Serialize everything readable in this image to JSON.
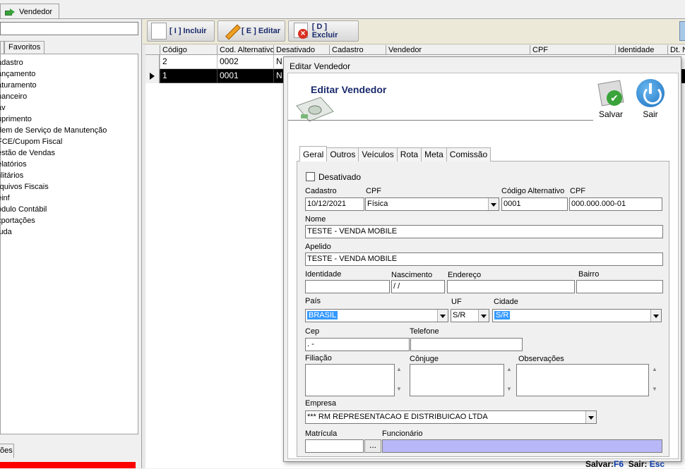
{
  "top_tab": {
    "label": "Vendedor"
  },
  "left": {
    "tabs": [
      "Favoritos"
    ],
    "tree": [
      "adastro",
      "ançamento",
      "aturamento",
      "nanceiro",
      "av",
      "uprimento",
      "dem de Serviço de Manutenção",
      "FCE/Cupom Fiscal",
      "estão de Vendas",
      "elatórios",
      "tilitários",
      "rquivos Fiscais",
      "einf",
      "ódulo Contábil",
      "xportações",
      "juda"
    ],
    "bottom_tab": "ões"
  },
  "toolbar": {
    "incluir": "[ I ] Incluir",
    "editar": "[ E ] Editar",
    "excluir": "[ D ] Excluir"
  },
  "grid": {
    "columns": [
      "Código",
      "Cod. Alternativo",
      "Desativado",
      "Cadastro",
      "Vendedor",
      "CPF",
      "Identidade",
      "Dt. N"
    ],
    "rows": [
      {
        "codigo": "2",
        "cod_alt": "0002",
        "desativado": "N"
      },
      {
        "codigo": "1",
        "cod_alt": "0001",
        "desativado": "N"
      }
    ]
  },
  "dialog": {
    "title": "Editar Vendedor",
    "header": "Editar Vendedor",
    "save_label": "Salvar",
    "exit_label": "Sair",
    "tabs": [
      "Geral",
      "Outros",
      "Veículos",
      "Rota",
      "Meta",
      "Comissão"
    ],
    "form": {
      "desativado_label": "Desativado",
      "cadastro_label": "Cadastro",
      "cadastro_value": "10/12/2021",
      "cpf_type_label": "CPF",
      "cpf_type_value": "Física",
      "cod_alt_label": "Código Alternativo",
      "cod_alt_value": "0001",
      "cpf_label": "CPF",
      "cpf_value": "000.000.000-01",
      "nome_label": "Nome",
      "nome_value": "TESTE - VENDA MOBILE",
      "apelido_label": "Apelido",
      "apelido_value": "TESTE - VENDA MOBILE",
      "identidade_label": "Identidade",
      "identidade_value": "",
      "nascimento_label": "Nascimento",
      "nascimento_value": " /  /",
      "endereco_label": "Endereço",
      "endereco_value": "",
      "bairro_label": "Bairro",
      "bairro_value": "",
      "pais_label": "País",
      "pais_value": "BRASIL",
      "uf_label": "UF",
      "uf_value": "S/R",
      "cidade_label": "Cidade",
      "cidade_value": "S/R",
      "cep_label": "Cep",
      "cep_value": "  .    -",
      "telefone_label": "Telefone",
      "telefone_value": "",
      "filiacao_label": "Filiação",
      "conjuge_label": "Cônjuge",
      "observacoes_label": "Observações",
      "empresa_label": "Empresa",
      "empresa_value": "*** RM REPRESENTACAO E DISTRIBUICAO LTDA",
      "matricula_label": "Matrícula",
      "matricula_value": "",
      "funcionario_label": "Funcionário",
      "funcionario_value": "",
      "ellipsis": "..."
    },
    "status": {
      "save_text": "Salvar:",
      "save_key": "F6",
      "exit_text": "Sair:",
      "exit_key": "Esc"
    }
  },
  "colors": {
    "selected_row": "#000000",
    "highlight": "#3399ff",
    "funcionario_bg": "#b8b8f8",
    "title_blue": "#1a2a6c",
    "red_bar": "#ff0000"
  }
}
